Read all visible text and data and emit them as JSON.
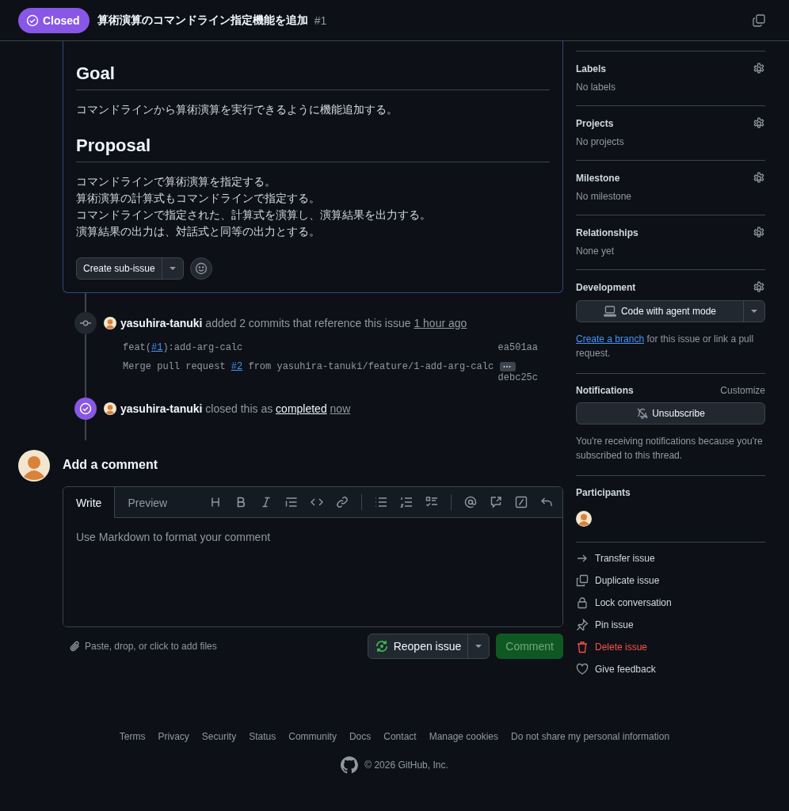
{
  "header": {
    "state_label": "Closed",
    "title": "算術演算のコマンドライン指定機能を追加",
    "number": "#1"
  },
  "body": {
    "sections": [
      {
        "heading": "Goal",
        "lines": [
          "コマンドラインから算術演算を実行できるように機能追加する。"
        ]
      },
      {
        "heading": "Proposal",
        "lines": [
          "コマンドラインで算術演算を指定する。",
          "算術演算の計算式もコマンドラインで指定する。",
          "コマンドラインで指定された、計算式を演算し、演算結果を出力する。",
          "演算結果の出力は、対話式と同等の出力とする。"
        ]
      }
    ],
    "sub_issue_button": "Create sub-issue"
  },
  "timeline": [
    {
      "kind": "commits",
      "actor": "yasuhira-tanuki",
      "text": "added 2 commits that reference this issue",
      "time": "1 hour ago",
      "commits": [
        {
          "before": "feat(",
          "ref": "#1",
          "after": "):add-arg-calc",
          "sha": "ea501aa",
          "kind": "single"
        },
        {
          "before": "Merge pull request ",
          "ref": "#2",
          "after": " from yasuhira-tanuki/feature/1-add-arg-calc",
          "sha": "debc25c",
          "kind": "merge"
        }
      ]
    },
    {
      "kind": "closed",
      "actor": "yasuhira-tanuki",
      "text": "closed this as",
      "link": "completed",
      "time": "now"
    }
  ],
  "comment": {
    "title": "Add a comment",
    "tabs": [
      {
        "label": "Write",
        "selected": true
      },
      {
        "label": "Preview",
        "selected": false
      }
    ],
    "placeholder": "Use Markdown to format your comment",
    "attach_hint": "Paste, drop, or click to add files",
    "reopen_label": "Reopen issue",
    "submit": {
      "label": "Comment",
      "disabled": true
    }
  },
  "sidebar": {
    "fields": [
      {
        "title": "Labels",
        "value": "No labels"
      },
      {
        "title": "Projects",
        "value": "No projects"
      },
      {
        "title": "Milestone",
        "value": "No milestone"
      },
      {
        "title": "Relationships",
        "value": "None yet"
      }
    ],
    "development": {
      "title": "Development",
      "button": "Code with agent mode",
      "link": "Create a branch",
      "text": " for this issue or link a pull request."
    },
    "notifications": {
      "title": "Notifications",
      "customize": "Customize",
      "button": "Unsubscribe",
      "note": "You're receiving notifications because you're subscribed to this thread."
    },
    "participants": {
      "title": "Participants"
    },
    "actions": [
      {
        "kind": "transfer",
        "label": "Transfer issue",
        "danger": false
      },
      {
        "kind": "duplicate",
        "label": "Duplicate issue",
        "danger": false
      },
      {
        "kind": "lock",
        "label": "Lock conversation",
        "danger": false
      },
      {
        "kind": "pin",
        "label": "Pin issue",
        "danger": false
      },
      {
        "kind": "delete",
        "label": "Delete issue",
        "danger": true
      },
      {
        "kind": "feedback",
        "label": "Give feedback",
        "danger": false
      }
    ]
  },
  "footer": {
    "links": [
      "Terms",
      "Privacy",
      "Security",
      "Status",
      "Community",
      "Docs",
      "Contact",
      "Manage cookies",
      "Do not share my personal information"
    ],
    "copyright": "© 2026 GitHub, Inc."
  }
}
